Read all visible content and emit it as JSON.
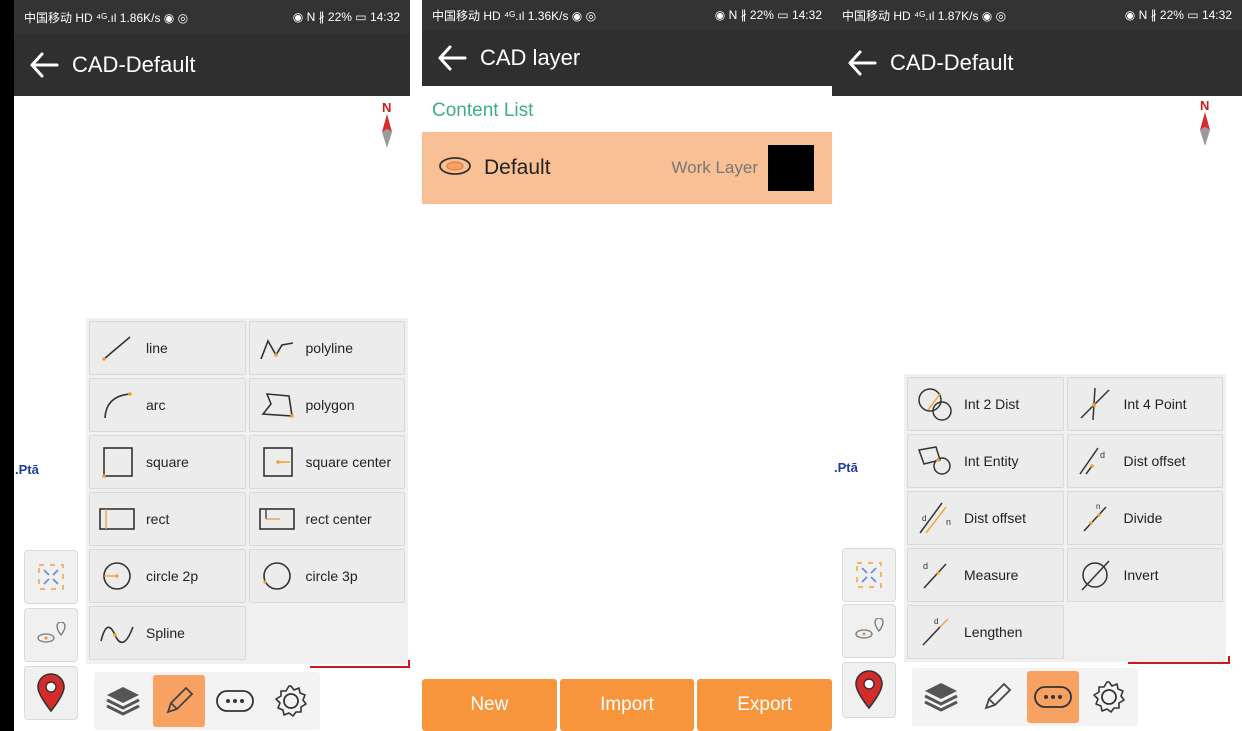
{
  "screens": [
    {
      "status": {
        "left": "中国移动 HD ⁴ᴳ.ıl 1.86K/s ◉ ◎",
        "right": "◉ N ∦ 22% ▭ 14:32"
      },
      "title": "CAD-Default",
      "north_label": "N",
      "point_label": ".Ptā",
      "tools": [
        {
          "label": "line",
          "icon": "line-icon"
        },
        {
          "label": "polyline",
          "icon": "polyline-icon"
        },
        {
          "label": "arc",
          "icon": "arc-icon"
        },
        {
          "label": "polygon",
          "icon": "polygon-icon"
        },
        {
          "label": "square",
          "icon": "square-icon"
        },
        {
          "label": "square center",
          "icon": "square-center-icon"
        },
        {
          "label": "rect",
          "icon": "rect-icon"
        },
        {
          "label": "rect center",
          "icon": "rect-center-icon"
        },
        {
          "label": "circle 2p",
          "icon": "circle-2p-icon"
        },
        {
          "label": "circle 3p",
          "icon": "circle-3p-icon"
        },
        {
          "label": "Spline",
          "icon": "spline-icon"
        }
      ],
      "bottom_active": "draw"
    },
    {
      "status": {
        "left": "中国移动 HD ⁴ᴳ.ıl 1.36K/s ◉ ◎",
        "right": "◉ N ∦ 22% ▭ 14:32"
      },
      "title": "CAD layer",
      "content_label": "Content List",
      "layer": {
        "name": "Default",
        "tag": "Work Layer",
        "color": "#000000"
      },
      "buttons": {
        "new": "New",
        "import": "Import",
        "export": "Export"
      }
    },
    {
      "status": {
        "left": "中国移动 HD ⁴ᴳ.ıl 1.87K/s ◉ ◎",
        "right": "◉ N ∦ 22% ▭ 14:32"
      },
      "title": "CAD-Default",
      "north_label": "N",
      "point_label": ".Ptā",
      "tools": [
        {
          "label": "Int 2 Dist",
          "icon": "int-2-dist-icon"
        },
        {
          "label": "Int 4 Point",
          "icon": "int-4-point-icon"
        },
        {
          "label": "Int Entity",
          "icon": "int-entity-icon"
        },
        {
          "label": "Dist offset",
          "icon": "dist-offset-icon"
        },
        {
          "label": "Dist offset",
          "icon": "dist-offset-2-icon"
        },
        {
          "label": "Divide",
          "icon": "divide-icon"
        },
        {
          "label": "Measure",
          "icon": "measure-icon"
        },
        {
          "label": "Invert",
          "icon": "invert-icon"
        },
        {
          "label": "Lengthen",
          "icon": "lengthen-icon"
        }
      ],
      "bottom_active": "more"
    }
  ],
  "colors": {
    "accent": "#f7953d",
    "active": "#f7a262",
    "layer_row": "#f9c095",
    "content_label": "#3fae87",
    "marker": "#d62b2b"
  }
}
